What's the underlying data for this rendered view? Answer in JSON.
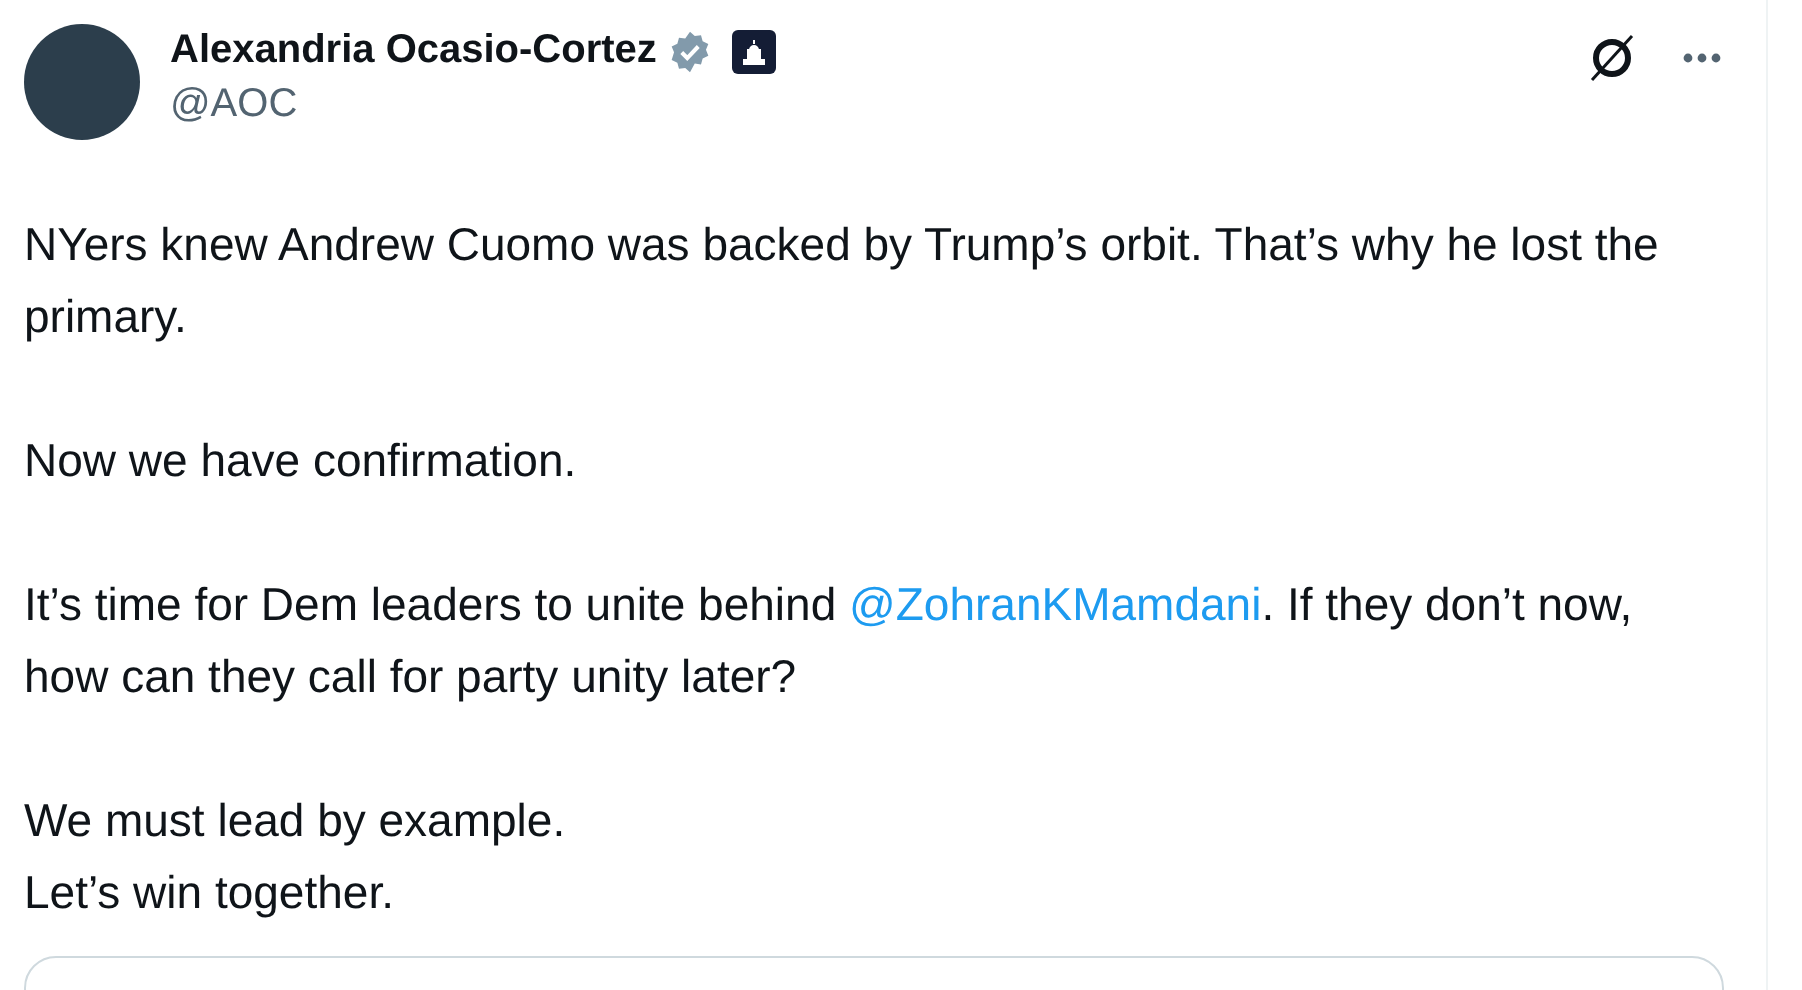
{
  "author": {
    "name": "Alexandria Ocasio-Cortez",
    "handle": "@AOC",
    "verified": true
  },
  "paragraphs": [
    {
      "lines": [
        [
          {
            "text": "NYers knew Andrew Cuomo was backed by Trump’s orbit. That’s why he lost the primary."
          }
        ]
      ]
    },
    {
      "lines": [
        [
          {
            "text": "Now we have confirmation."
          }
        ]
      ]
    },
    {
      "lines": [
        [
          {
            "text": "It’s time for Dem leaders to unite behind "
          },
          {
            "text": "@ZohranKMamdani",
            "kind": "mention"
          },
          {
            "text": ". If they don’t now, how can they call for party unity later?"
          }
        ]
      ]
    },
    {
      "lines": [
        [
          {
            "text": "We must lead by example."
          }
        ],
        [
          {
            "text": "Let’s win together."
          }
        ]
      ]
    }
  ]
}
